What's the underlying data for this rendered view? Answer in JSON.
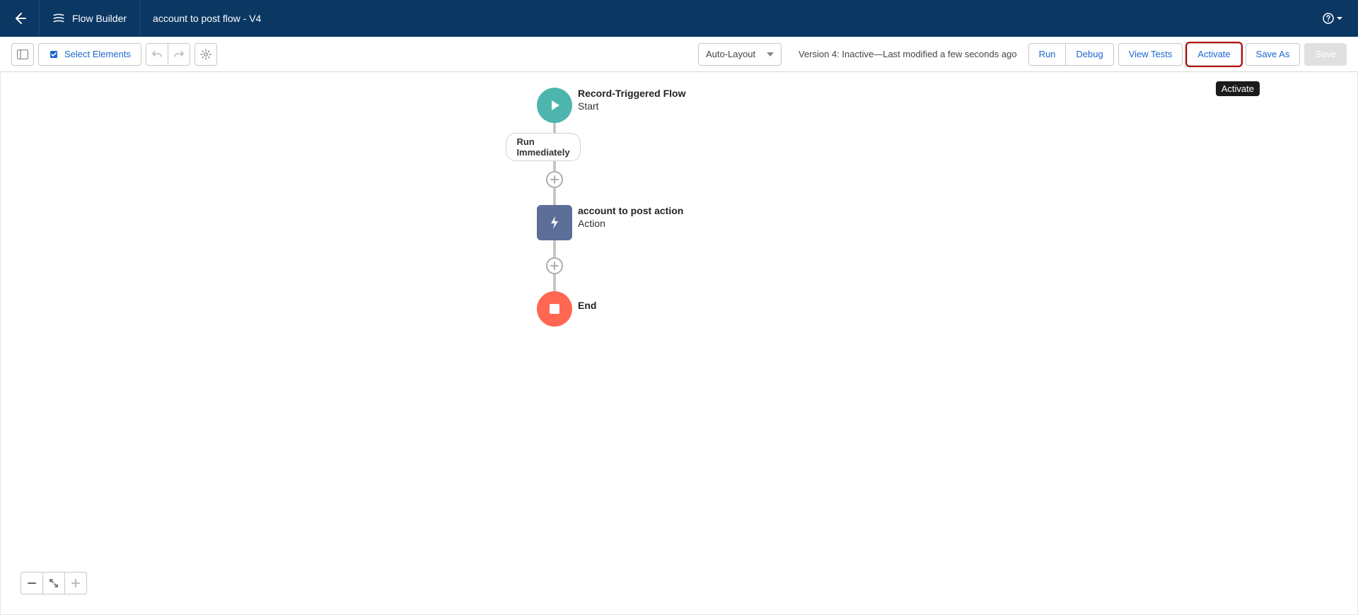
{
  "header": {
    "app": "Flow Builder",
    "flow_name": "account to post flow - V4"
  },
  "toolbar": {
    "select_elements": "Select Elements",
    "layout_mode": "Auto-Layout",
    "status": "Version 4: Inactive—Last modified a few seconds ago",
    "run": "Run",
    "debug": "Debug",
    "view_tests": "View Tests",
    "activate": "Activate",
    "save_as": "Save As",
    "save": "Save"
  },
  "tooltip": "Activate",
  "flow": {
    "start": {
      "title": "Record-Triggered Flow",
      "sub": "Start"
    },
    "path_label": "Run Immediately",
    "action": {
      "title": "account to post action",
      "sub": "Action"
    },
    "end": {
      "title": "End"
    }
  }
}
